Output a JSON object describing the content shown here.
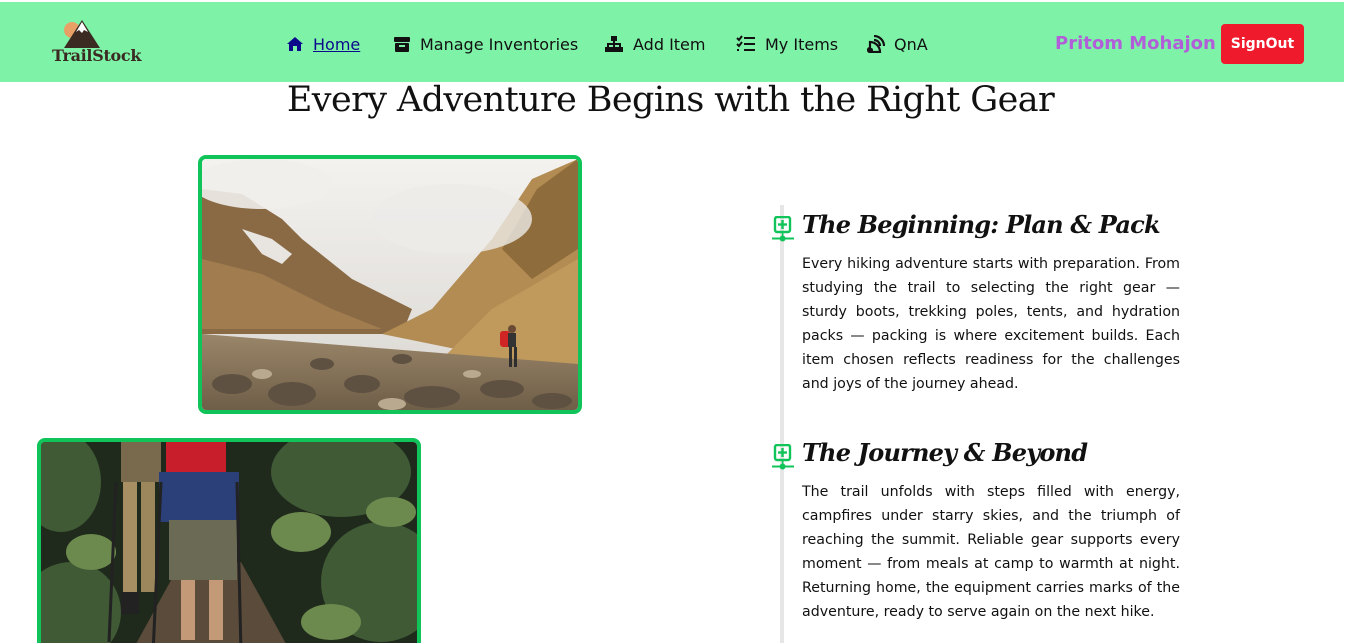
{
  "navbar": {
    "logo_text": "TrailStock",
    "items": [
      {
        "label": "Home",
        "icon": "home-icon",
        "active": true
      },
      {
        "label": "Manage Inventories",
        "icon": "archive-icon"
      },
      {
        "label": "Add Item",
        "icon": "sitemap-icon"
      },
      {
        "label": "My Items",
        "icon": "list-check-icon"
      },
      {
        "label": "QnA",
        "icon": "blog-icon"
      }
    ],
    "user_name": "Pritom Mohajon",
    "signout_label": "SignOut",
    "colors": {
      "bar": "#7ef3a8",
      "user": "#b25ed8",
      "signout": "#ef1b2d"
    }
  },
  "main": {
    "title": "Every Adventure Begins with the Right Gear",
    "sections": [
      {
        "title": "The Beginning: Plan & Pack",
        "text": "Every hiking adventure starts with preparation. From studying the trail to selecting the right gear — sturdy boots, trekking poles, tents, and hydration packs — packing is where excitement builds. Each item chosen reflects readiness for the challenges and joys of the journey ahead."
      },
      {
        "title": "The Journey & Beyond",
        "text": "The trail unfolds with steps filled with energy, campfires under starry skies, and the triumph of reaching the summit. Reliable gear supports every moment — from meals at camp to warmth at night. Returning home, the equipment carries marks of the adventure, ready to serve again on the next hike."
      }
    ],
    "accent_color": "#11c45a"
  }
}
